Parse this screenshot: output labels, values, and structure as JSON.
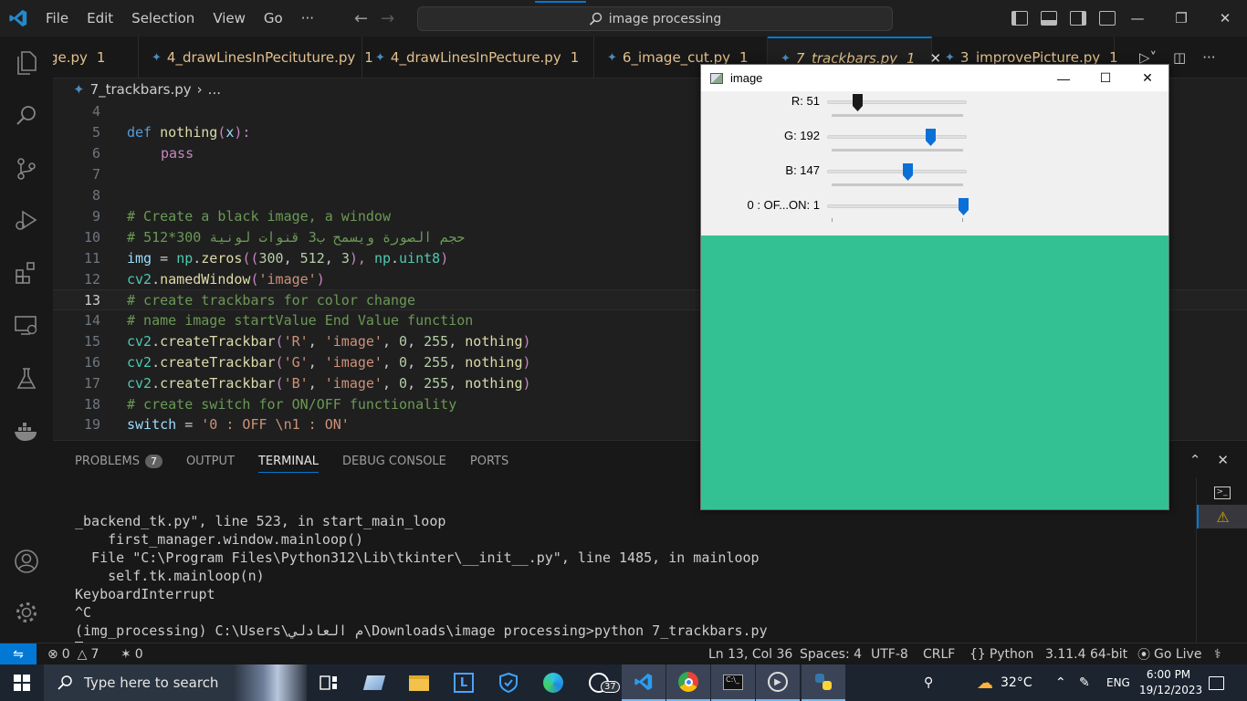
{
  "titlebar": {
    "menu": [
      "File",
      "Edit",
      "Selection",
      "View",
      "Go",
      "···"
    ],
    "search_text": "image processing"
  },
  "tabs": [
    {
      "label": "ge.py",
      "errors": "1"
    },
    {
      "label": "4_drawLinesInPecituture.py",
      "errors": "1"
    },
    {
      "label": "4_drawLinesInPecture.py",
      "errors": "1"
    },
    {
      "label": "6_image_cut.py",
      "errors": "1"
    },
    {
      "label": "7_trackbars.py",
      "errors": "1"
    },
    {
      "label": "3_improvePicture.py",
      "errors": "1"
    }
  ],
  "breadcrumb": {
    "file": "7_trackbars.py",
    "sep": "›",
    "more": "..."
  },
  "editor": {
    "line_numbers": [
      "4",
      "5",
      "6",
      "7",
      "8",
      "9",
      "10",
      "11",
      "12",
      "13",
      "14",
      "15",
      "16",
      "17",
      "18",
      "19"
    ],
    "current_line": "13",
    "lines": {
      "l5a": "def ",
      "l5b": "nothing",
      "l5c": "(",
      "l5d": "x",
      "l5e": "):",
      "l6": "pass",
      "l9": "# Create a black image, a window",
      "l10": "# حجم الصورة ويسمح ب3 قنوات لونية 300*512",
      "l11a": "img",
      "l11b": " = ",
      "l11c": "np",
      "l11d": ".",
      "l11e": "zeros",
      "l11f": "((",
      "l11g": "300",
      "l11h": ", ",
      "l11i": "512",
      "l11j": ", ",
      "l11k": "3",
      "l11l": "), ",
      "l11m": "np",
      "l11n": ".",
      "l11o": "uint8",
      "l11p": ")",
      "l12a": "cv2",
      "l12b": ".",
      "l12c": "namedWindow",
      "l12d": "(",
      "l12e": "'image'",
      "l12f": ")",
      "l13": "# create trackbars for color change",
      "l14": "# name image startValue End Value function",
      "l15a": "cv2",
      "l15b": ".",
      "l15c": "createTrackbar",
      "l15d": "(",
      "l15e": "'R'",
      "l15f": ", ",
      "l15g": "'image'",
      "l15h": ", ",
      "l15i": "0",
      "l15j": ", ",
      "l15k": "255",
      "l15l": ", ",
      "l15m": "nothing",
      "l15n": ")",
      "l16e": "'G'",
      "l17e": "'B'",
      "l18": "# create switch for ON/OFF functionality",
      "l19a": "switch",
      "l19b": " = ",
      "l19c": "'0 : OFF \\n1 : ON'"
    }
  },
  "panel": {
    "tabs": {
      "problems": "PROBLEMS",
      "problems_count": "7",
      "output": "OUTPUT",
      "terminal": "TERMINAL",
      "debug": "DEBUG CONSOLE",
      "ports": "PORTS"
    },
    "terminal_lines": [
      "_backend_tk.py\", line 523, in start_main_loop",
      "    first_manager.window.mainloop()",
      "  File \"C:\\Program Files\\Python312\\Lib\\tkinter\\__init__.py\", line 1485, in mainloop",
      "    self.tk.mainloop(n)",
      "KeyboardInterrupt",
      "^C",
      "(img_processing) C:\\Users\\م العادلي\\Downloads\\image processing>python 7_trackbars.py"
    ]
  },
  "statusbar": {
    "errors": "0",
    "warnings": "7",
    "ports": "0",
    "position": "Ln 13, Col 36",
    "spaces": "Spaces: 4",
    "encoding": "UTF-8",
    "eol": "CRLF",
    "language": "Python",
    "interpreter": "3.11.4 64-bit",
    "live": "Go Live"
  },
  "taskbar": {
    "search_placeholder": "Type here to search",
    "whatsapp_badge": "37",
    "temperature": "32°C",
    "language": "ENG",
    "time": "6:00 PM",
    "date": "19/12/2023"
  },
  "cv_window": {
    "title": "image",
    "trackbars": [
      {
        "label": "R: 51",
        "value": 51,
        "max": 255
      },
      {
        "label": "G: 192",
        "value": 192,
        "max": 255
      },
      {
        "label": "B: 147",
        "value": 147,
        "max": 255
      },
      {
        "label": "0 : OF...ON: 1",
        "value": 1,
        "max": 1
      }
    ],
    "image_color": "#33c193"
  },
  "colors": {
    "accent": "#0078d4",
    "tab_modified": "#e2c08d",
    "image_fill": "#33c193"
  }
}
